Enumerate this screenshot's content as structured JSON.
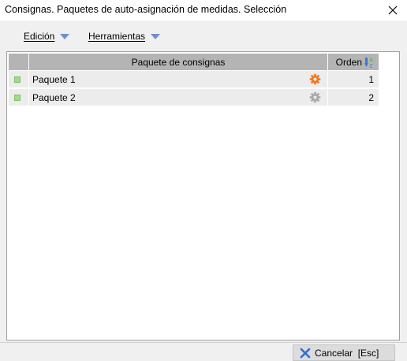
{
  "window": {
    "title": "Consignas. Paquetes de auto-asignación de medidas. Selección",
    "close_icon": "close-icon"
  },
  "menu": {
    "items": [
      {
        "label": "Edición",
        "icon": "chevron-down-icon"
      },
      {
        "label": "Herramientas",
        "icon": "chevron-down-icon"
      }
    ]
  },
  "grid": {
    "columns": {
      "package": "Paquete de consignas",
      "order": "Orden",
      "order_icon": "sort-az-icon"
    },
    "rows": [
      {
        "name": "Paquete 1",
        "order": "1",
        "gear_icon": "gear-icon",
        "gear_color": "#f07820"
      },
      {
        "name": "Paquete 2",
        "order": "2",
        "gear_icon": "gear-icon",
        "gear_color": "#a8a8a8"
      }
    ],
    "row_marker_color": "#a6d98e"
  },
  "footer": {
    "cancel_label": "Cancelar  [Esc]",
    "cancel_icon": "cancel-x-icon"
  }
}
